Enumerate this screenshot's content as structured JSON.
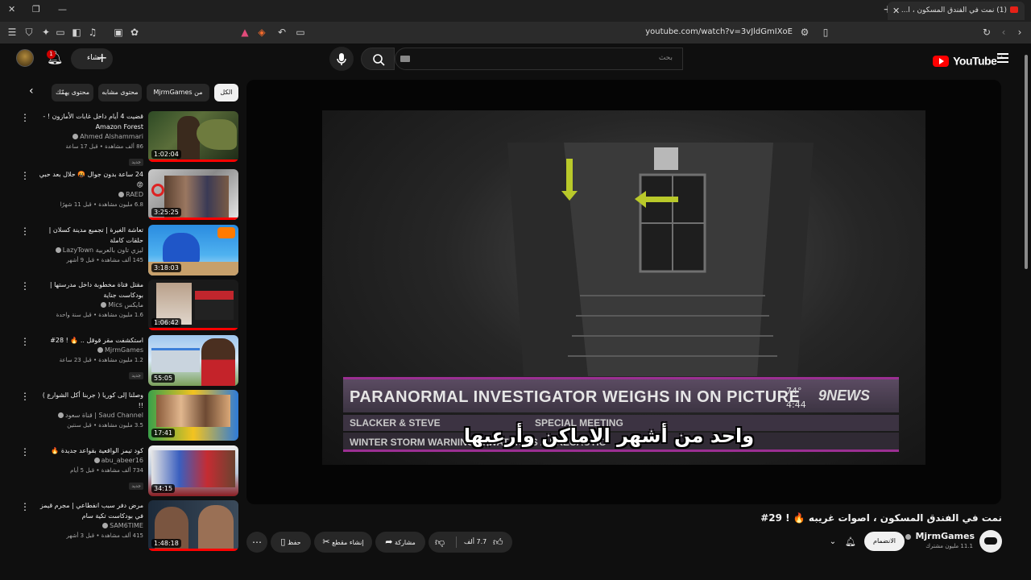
{
  "browser": {
    "tab_title": "(1) نمت في الفندق المسكون ، ا...",
    "url": "youtube.com/watch?v=3vJldGmIXoE"
  },
  "header": {
    "logo_text": "YouTube",
    "logo_region": "SA",
    "search_placeholder": "بحث",
    "create_label": "إنشاء",
    "notification_count": "1"
  },
  "chips": [
    {
      "label": "الكل",
      "active": true
    },
    {
      "label": "من MjrmGames",
      "active": false
    },
    {
      "label": "محتوى مشابه",
      "active": false
    },
    {
      "label": "محتوى يهمّك",
      "active": false
    }
  ],
  "recommendations": [
    {
      "title": "قضيت 4 أيام داخل غابات الأمازون ! - Amazon Forest",
      "channel": "Ahmed Alshammari",
      "meta": "86 ألف مشاهدة • قبل 17 ساعة",
      "badge": "جديد",
      "duration": "1:02:04"
    },
    {
      "title": "24 ساعة بدون جوال 🤬 حلال بعد حبي 😡",
      "channel": "RAED",
      "meta": "6.8 مليون مشاهدة • قبل 11 شهرًا",
      "badge": "",
      "duration": "3:25:25"
    },
    {
      "title": "تعاشة الغيرة | تجميع مدينة كسلان | حلقات كاملة",
      "channel": "ليزي تاون بالعربية LazyTown",
      "meta": "145 ألف مشاهدة • قبل 9 أشهر",
      "badge": "",
      "duration": "3:18:03"
    },
    {
      "title": "مقتل فتاة مخطوبة داخل مدرستها | بودكاست جناية",
      "channel": "مايكس Mics",
      "meta": "1.6 مليون مشاهدة • قبل سنة واحدة",
      "badge": "",
      "duration": "1:06:42"
    },
    {
      "title": "استكشفت مقر قوقل .. 🔥 ! 28#",
      "channel": "MjrmGames",
      "meta": "1.2 مليون مشاهدة • قبل 23 ساعة",
      "badge": "جديد",
      "duration": "55:05"
    },
    {
      "title": "وصلنا إلى كوريا ( جربنا أكل الشوارع ) !!",
      "channel": "Saud Channel | قناة سعود",
      "meta": "3.5 مليون مشاهدة • قبل سنتين",
      "badge": "",
      "duration": "17:41"
    },
    {
      "title": "كود تيمز الواقعية بقواعد جديدة 🔥",
      "channel": "abu_abeer16",
      "meta": "734 ألف مشاهدة • قبل 5 أيام",
      "badge": "جديد",
      "duration": "34:15"
    },
    {
      "title": "مرض دفر سبب انفطاعي | مجرم قيمز في بودكاست تكية سام",
      "channel": "SAM6TIME",
      "meta": "415 ألف مشاهدة • قبل 3 أشهر",
      "badge": "",
      "duration": "1:48:18"
    }
  ],
  "video": {
    "lower_third_headline": "PARANORMAL INVESTIGATOR WEIGHS IN ON PICTURE",
    "temperature": "74°",
    "clock": "4:44",
    "station_logo": "9NEWS",
    "ticker_left": "SLACKER & STEVE",
    "ticker_right": "SPECIAL MEETING",
    "ticker_bottom": "WINTER STORM WARNING ... WATER AS A PRECAUTIO",
    "subtitle": "واحد من أشهر الاماكن وأرعبها",
    "title": "نمت في الفندق المسكون ، اصوات غريبه 🔥 ! 29#"
  },
  "channel": {
    "name": "MjrmGames",
    "subscribers": "11.1 مليون مشترك",
    "join_label": "الانضمام"
  },
  "actions": {
    "likes": "7.7 ألف",
    "share": "مشاركة",
    "clip": "إنشاء مقطع",
    "save": "حفظ"
  },
  "colors": {
    "accent": "#ff0000",
    "background": "#0f0f0f",
    "chip_bg": "#272727",
    "lower_third_purple": "#9b2f92"
  }
}
